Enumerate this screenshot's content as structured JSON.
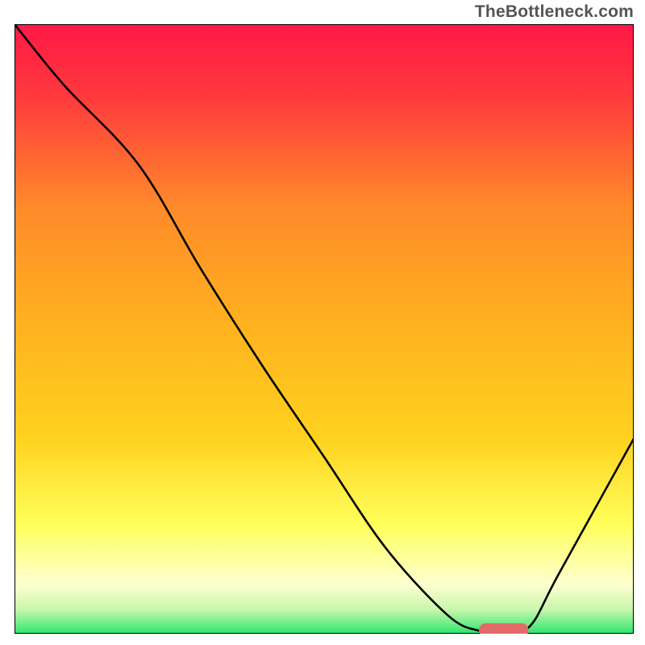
{
  "watermark": "TheBottleneck.com",
  "chart_data": {
    "type": "line",
    "title": "",
    "xlabel": "",
    "ylabel": "",
    "xlim": [
      0,
      100
    ],
    "ylim": [
      0,
      100
    ],
    "grid": false,
    "legend": false,
    "series": [
      {
        "name": "bottleneck-curve",
        "color": "#000000",
        "x": [
          0,
          8,
          20,
          30,
          40,
          50,
          60,
          70,
          75,
          78,
          83,
          88,
          100
        ],
        "y": [
          100,
          90,
          77,
          60,
          44,
          29,
          14,
          3,
          0.5,
          0.5,
          1,
          10,
          32
        ]
      }
    ],
    "marker": {
      "name": "highlight-segment",
      "color": "#e46a6a",
      "x_start": 75,
      "x_end": 83,
      "y": 0.6,
      "thickness": 2.2
    },
    "background_gradient": {
      "top": "#ff1846",
      "mid_upper": "#ff8a2a",
      "mid": "#ffd21f",
      "mid_lower": "#ffff5a",
      "lower": "#fdffd0",
      "bottom": "#2ee66f"
    }
  }
}
